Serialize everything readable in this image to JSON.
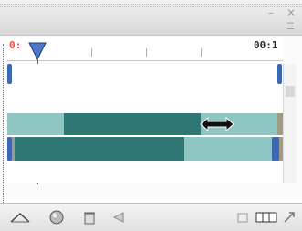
{
  "window": {
    "minimize_icon": "minimize-icon",
    "close_icon": "close-icon",
    "menu_icon": "panel-menu-icon"
  },
  "timeline": {
    "time_start": "0:",
    "time_end": "00:1"
  },
  "colors": {
    "track_light": "#8fc6c4",
    "track_dark": "#2f7774",
    "track_gold": "#a09a86",
    "handle_blue": "#3a68b4",
    "playhead": "#3366aa"
  },
  "toolbar": {
    "icons": [
      "onion-skin-icon",
      "sphere-icon",
      "delete-icon",
      "tween-icon",
      "hide-icon",
      "frames-icon",
      "convert-icon"
    ]
  },
  "cursor": {
    "icon": "resize-horizontal-cursor-icon"
  }
}
